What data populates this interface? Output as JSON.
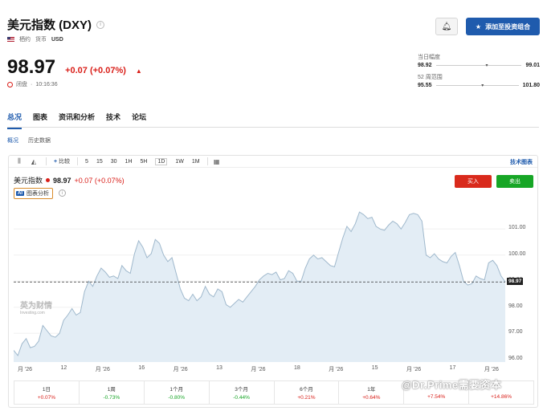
{
  "header": {
    "title": "美元指数 (DXY)",
    "market": "栖约",
    "currency_label": "货币",
    "currency": "USD",
    "price": "98.97",
    "change": "+0.07 (+0.07%)",
    "status": "闭盘",
    "time": "10:16:36",
    "add_button": "添加至投资组合"
  },
  "ranges": {
    "day": {
      "label": "当日幅度",
      "low": "98.92",
      "high": "99.01",
      "position": 0.58
    },
    "week52": {
      "label": "52 周范围",
      "low": "95.55",
      "high": "101.80",
      "position": 0.55
    }
  },
  "tabs": [
    "总况",
    "图表",
    "资讯和分析",
    "技术",
    "论坛"
  ],
  "subtabs": [
    "概况",
    "历史数据"
  ],
  "toolbar": {
    "compare": "比较",
    "periods": [
      "5",
      "15",
      "30",
      "1H",
      "5H",
      "1D",
      "1W",
      "1M"
    ],
    "tech_chart": "技术图表"
  },
  "legend": {
    "name": "美元指数",
    "price": "98.97",
    "change": "+0.07 (+0.07%)",
    "analysis_label": "图表分析",
    "ai_badge": "AI",
    "buy": "买入",
    "sell": "卖出"
  },
  "watermark": {
    "line1": "英为财情",
    "line2": "Investing.com"
  },
  "colors": {
    "accent": "#1f5bad",
    "up": "#d91e18",
    "down": "#17a626",
    "area": "#e3edf5",
    "line": "#9fb8cc"
  },
  "chart_data": {
    "type": "area",
    "y_ticks": [
      "101.00",
      "100.00",
      "99.00",
      "98.00",
      "97.00",
      "96.00"
    ],
    "ylim": [
      95.9,
      101.9
    ],
    "last_price": "98.97",
    "last_value": 98.97,
    "x_ticks": [
      "月 '26",
      "12",
      "月 '26",
      "16",
      "月 '26",
      "13",
      "月 '26",
      "18",
      "月 '26",
      "15",
      "月 '26",
      "17",
      "月 '26"
    ],
    "values": [
      96.35,
      96.15,
      96.6,
      96.8,
      96.45,
      96.5,
      96.7,
      97.3,
      97.1,
      96.9,
      96.85,
      97.0,
      97.5,
      97.7,
      97.95,
      97.7,
      97.8,
      98.6,
      99.0,
      98.8,
      99.2,
      99.5,
      99.35,
      99.15,
      99.2,
      99.1,
      99.6,
      99.4,
      99.3,
      100.05,
      100.55,
      100.3,
      99.9,
      100.05,
      100.6,
      100.45,
      100.0,
      99.75,
      99.9,
      99.3,
      98.7,
      98.35,
      98.25,
      98.5,
      98.25,
      98.4,
      98.8,
      98.5,
      98.4,
      98.7,
      98.6,
      98.1,
      98.0,
      98.15,
      98.3,
      98.2,
      98.4,
      98.6,
      98.8,
      99.05,
      99.2,
      99.3,
      99.25,
      99.35,
      99.05,
      99.1,
      99.4,
      99.3,
      99.0,
      99.0,
      99.5,
      99.85,
      100.0,
      99.85,
      99.9,
      99.75,
      99.6,
      99.55,
      100.1,
      100.65,
      101.1,
      100.9,
      101.2,
      101.65,
      101.55,
      101.4,
      101.45,
      101.1,
      101.0,
      100.95,
      101.15,
      101.3,
      101.2,
      101.0,
      101.25,
      101.55,
      101.6,
      101.55,
      101.3,
      100.0,
      99.9,
      100.05,
      99.85,
      99.75,
      99.7,
      99.95,
      100.1,
      99.6,
      99.0,
      98.85,
      98.9,
      99.2,
      99.1,
      99.05,
      99.7,
      99.8,
      99.6,
      99.2,
      98.97
    ]
  },
  "performance": [
    {
      "label": "1日",
      "value": "+0.07%",
      "dir": "pos"
    },
    {
      "label": "1周",
      "value": "-0.73%",
      "dir": "neg"
    },
    {
      "label": "1个月",
      "value": "-0.80%",
      "dir": "neg"
    },
    {
      "label": "3个月",
      "value": "-0.44%",
      "dir": "neg"
    },
    {
      "label": "6个月",
      "value": "+0.21%",
      "dir": "pos"
    },
    {
      "label": "1年",
      "value": "+0.64%",
      "dir": "pos"
    },
    {
      "label": "",
      "value": "+7.54%",
      "dir": "pos"
    },
    {
      "label": "",
      "value": "+14.86%",
      "dir": "pos"
    }
  ],
  "footer_watermark": "@Dr.Prime需要资本"
}
